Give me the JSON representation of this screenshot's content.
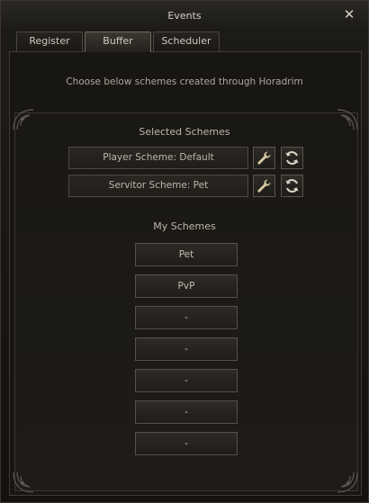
{
  "window": {
    "title": "Events"
  },
  "tabs": [
    {
      "label": "Register",
      "active": false
    },
    {
      "label": "Buffer",
      "active": true
    },
    {
      "label": "Scheduler",
      "active": false
    }
  ],
  "intro_text": "Choose below schemes created through Horadrim",
  "selected": {
    "title": "Selected Schemes",
    "rows": [
      {
        "label": "Player Scheme: Default"
      },
      {
        "label": "Servitor Scheme: Pet"
      }
    ]
  },
  "my_schemes": {
    "title": "My Schemes",
    "buttons": [
      "Pet",
      "PvP",
      "-",
      "-",
      "-",
      "-",
      "-"
    ]
  },
  "icons": {
    "edit": "wrench-icon",
    "swap": "refresh-icon",
    "close": "close-icon"
  },
  "colors": {
    "accent": "#c9a35a",
    "text": "#b8b2a6"
  }
}
